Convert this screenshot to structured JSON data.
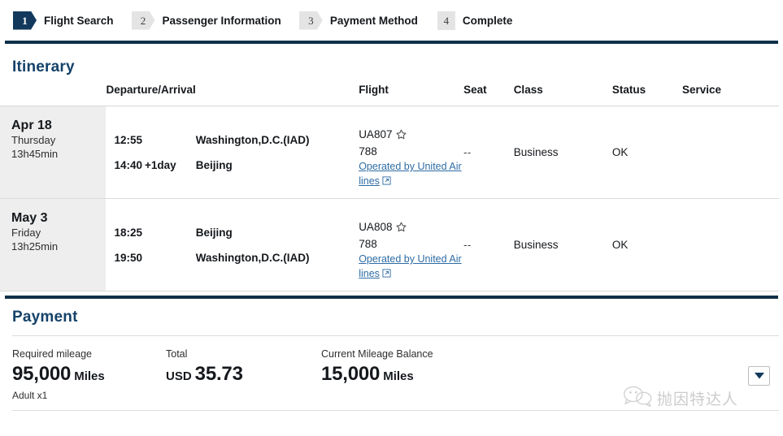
{
  "steps": [
    {
      "number": "1",
      "label": "Flight Search",
      "state": "active",
      "shape": "arrow"
    },
    {
      "number": "2",
      "label": "Passenger Information",
      "state": "inactive",
      "shape": "arrow"
    },
    {
      "number": "3",
      "label": "Payment Method",
      "state": "inactive",
      "shape": "arrow"
    },
    {
      "number": "4",
      "label": "Complete",
      "state": "inactive",
      "shape": "square"
    }
  ],
  "itinerary": {
    "title": "Itinerary",
    "columns": {
      "date": "",
      "departure_arrival": "Departure/Arrival",
      "times": "",
      "flight": "Flight",
      "seat": "Seat",
      "class": "Class",
      "status": "Status",
      "service": "Service"
    },
    "rows": [
      {
        "date": "Apr 18",
        "weekday": "Thursday",
        "duration": "13h45min",
        "depart_time": "12:55",
        "depart_day_offset": "",
        "depart_city": "Washington,D.C.(IAD)",
        "arrive_time": "14:40",
        "arrive_day_offset": "+1day",
        "arrive_city": "Beijing",
        "flight_number": "UA807",
        "flight_icon": "star-icon",
        "equipment": "788",
        "operated_by": "Operated by United Airlines",
        "operated_icon": "external-link-icon",
        "seat": "--",
        "class": "Business",
        "status": "OK",
        "service": ""
      },
      {
        "date": "May 3",
        "weekday": "Friday",
        "duration": "13h25min",
        "depart_time": "18:25",
        "depart_day_offset": "",
        "depart_city": "Beijing",
        "arrive_time": "19:50",
        "arrive_day_offset": "",
        "arrive_city": "Washington,D.C.(IAD)",
        "flight_number": "UA808",
        "flight_icon": "star-icon",
        "equipment": "788",
        "operated_by": "Operated by United Airlines",
        "operated_icon": "external-link-icon",
        "seat": "--",
        "class": "Business",
        "status": "OK",
        "service": ""
      }
    ]
  },
  "payment": {
    "title": "Payment",
    "required_mileage": {
      "label": "Required mileage",
      "amount": "95,000",
      "unit": "Miles",
      "note": "Adult x1"
    },
    "total": {
      "label": "Total",
      "currency": "USD",
      "amount": "35.73"
    },
    "current_balance": {
      "label": "Current Mileage Balance",
      "amount": "15,000",
      "unit": "Miles"
    },
    "expand_button_icon": "chevron-down-icon"
  },
  "watermark": {
    "icon": "wechat-icon",
    "text": "抛因特达人"
  },
  "colors": {
    "navy": "#0f3049",
    "heading": "#154269",
    "link": "#2e6ca4",
    "row_date_bg": "#eeeeee",
    "step_active_bg": "#12395c",
    "step_inactive_bg": "#e4e4e4"
  }
}
